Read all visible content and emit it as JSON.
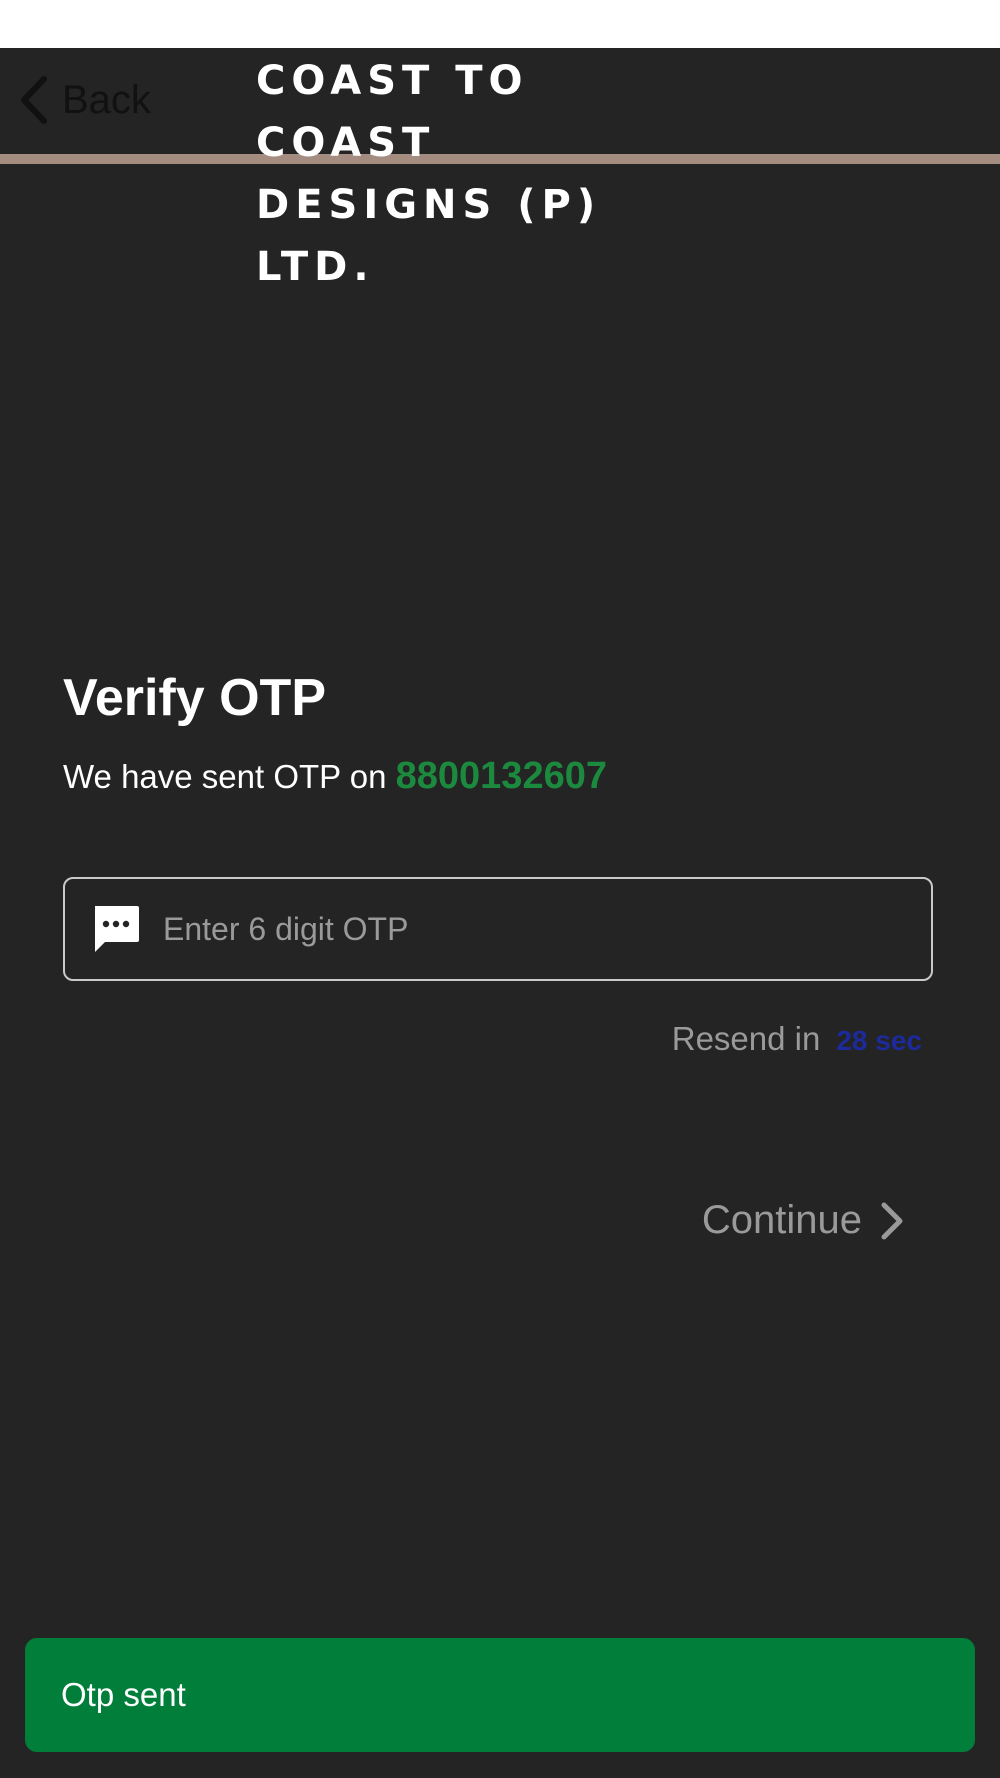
{
  "header": {
    "back_label": "Back",
    "brand_line1": "COAST TO COAST",
    "brand_line2": "DESIGNS (P) LTD."
  },
  "verify": {
    "title": "Verify OTP",
    "sent_text": "We have sent OTP on",
    "phone_number": "8800132607"
  },
  "otp_field": {
    "placeholder": "Enter 6 digit OTP",
    "value": "",
    "icon": "message-icon"
  },
  "resend": {
    "label": "Resend in",
    "timer": "28 sec"
  },
  "continue": {
    "label": "Continue",
    "icon": "chevron-right-icon"
  },
  "toast": {
    "message": "Otp sent"
  },
  "colors": {
    "background": "#242424",
    "accent_green": "#1b8a3e",
    "toast_green": "#017f3a",
    "timer_blue": "#1c2a9c",
    "header_rule": "#a58c80"
  }
}
